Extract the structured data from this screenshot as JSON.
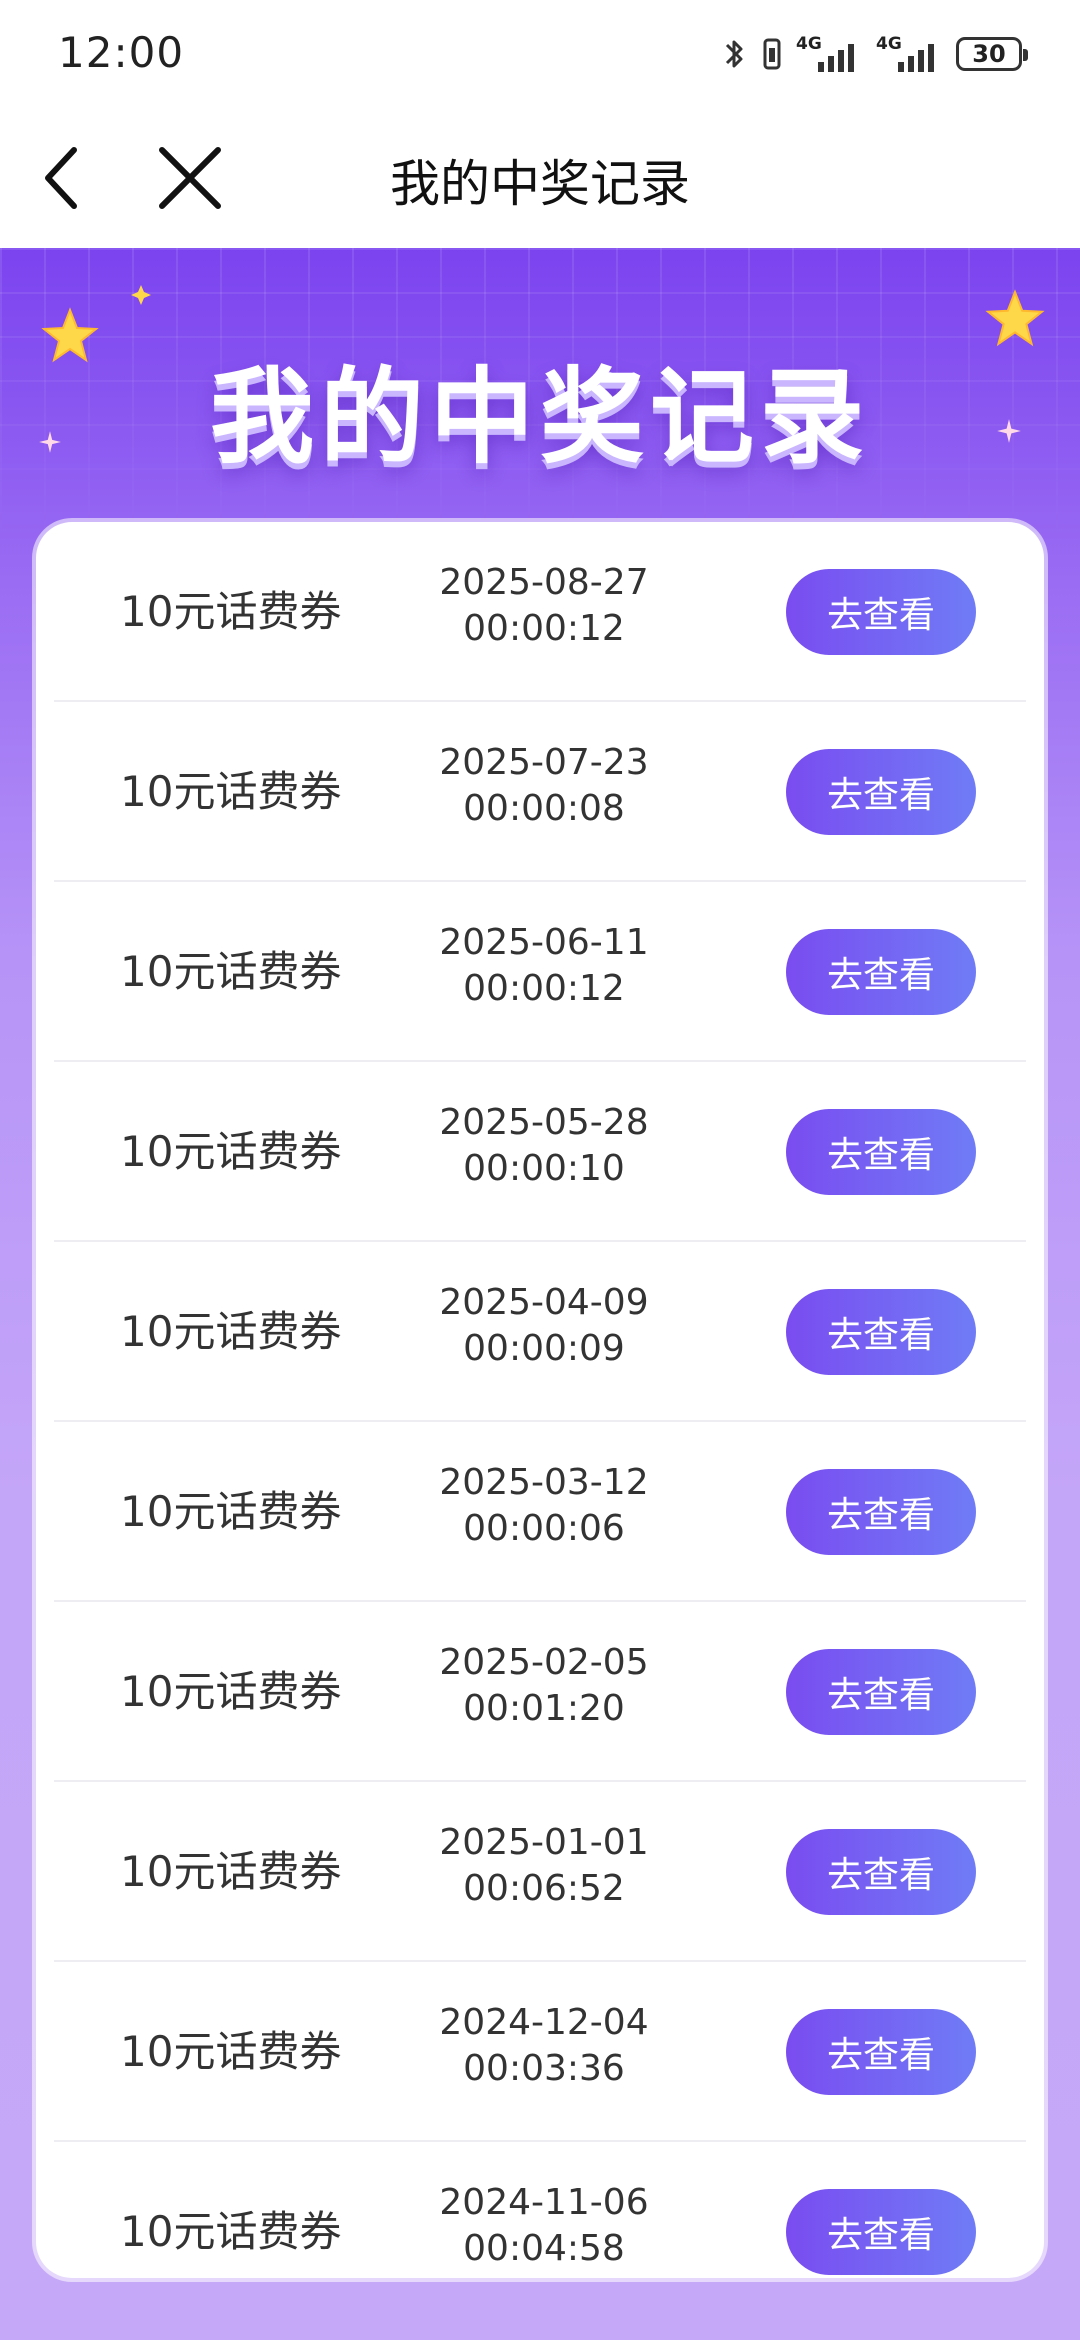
{
  "status_bar": {
    "time": "12:00",
    "network_1": "4G",
    "network_2": "4G",
    "battery": "30"
  },
  "nav": {
    "title": "我的中奖记录"
  },
  "hero": {
    "title": "我的中奖记录"
  },
  "records": [
    {
      "prize": "10元话费券",
      "date": "2025-08-27",
      "time": "00:00:12",
      "action": "去查看"
    },
    {
      "prize": "10元话费券",
      "date": "2025-07-23",
      "time": "00:00:08",
      "action": "去查看"
    },
    {
      "prize": "10元话费券",
      "date": "2025-06-11",
      "time": "00:00:12",
      "action": "去查看"
    },
    {
      "prize": "10元话费券",
      "date": "2025-05-28",
      "time": "00:00:10",
      "action": "去查看"
    },
    {
      "prize": "10元话费券",
      "date": "2025-04-09",
      "time": "00:00:09",
      "action": "去查看"
    },
    {
      "prize": "10元话费券",
      "date": "2025-03-12",
      "time": "00:00:06",
      "action": "去查看"
    },
    {
      "prize": "10元话费券",
      "date": "2025-02-05",
      "time": "00:01:20",
      "action": "去查看"
    },
    {
      "prize": "10元话费券",
      "date": "2025-01-01",
      "time": "00:06:52",
      "action": "去查看"
    },
    {
      "prize": "10元话费券",
      "date": "2024-12-04",
      "time": "00:03:36",
      "action": "去查看"
    },
    {
      "prize": "10元话费券",
      "date": "2024-11-06",
      "time": "00:04:58",
      "action": "去查看"
    }
  ],
  "colors": {
    "accent": "#7a4cf0",
    "background_top": "#7b43ef",
    "background_bottom": "#c6a8f8"
  },
  "icons": [
    "bluetooth-icon",
    "vibrate-icon",
    "signal-icon",
    "battery-icon",
    "back-arrow-icon",
    "close-icon",
    "star-icon",
    "sparkle-icon"
  ]
}
